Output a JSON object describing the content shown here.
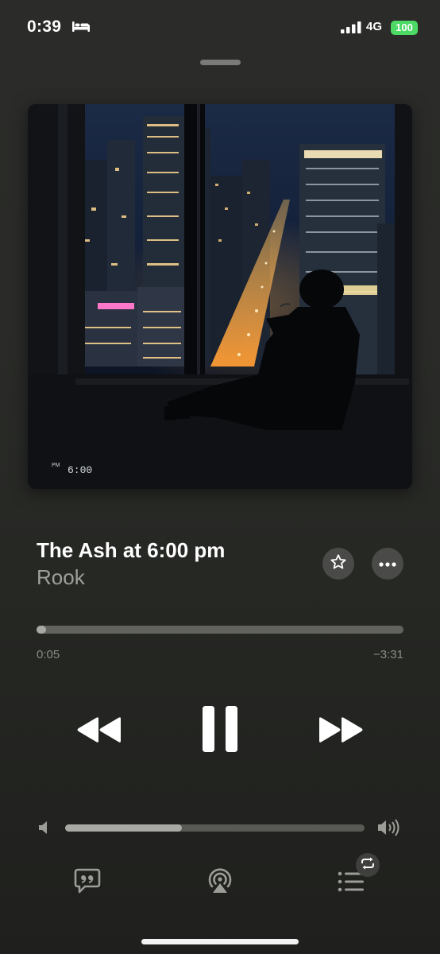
{
  "status_bar": {
    "time": "0:39",
    "network": "4G",
    "battery": "100",
    "icons": [
      "bed-icon",
      "cellular-signal-icon"
    ]
  },
  "artwork": {
    "clock_prefix": "PM",
    "clock_time": "6:00"
  },
  "now_playing": {
    "title": "The Ash at 6:00 pm",
    "artist": "Rook"
  },
  "progress": {
    "elapsed": "0:05",
    "remaining": "−3:31",
    "fraction": 0.023
  },
  "volume": {
    "fraction": 0.39
  },
  "controls": {
    "icons": [
      "rewind-icon",
      "pause-icon",
      "fast-forward-icon",
      "star-icon",
      "more-icon",
      "lyrics-icon",
      "airplay-icon",
      "queue-icon",
      "repeat-icon"
    ]
  },
  "colors": {
    "accent_battery": "#4cd964",
    "background": "#2a2b28"
  }
}
